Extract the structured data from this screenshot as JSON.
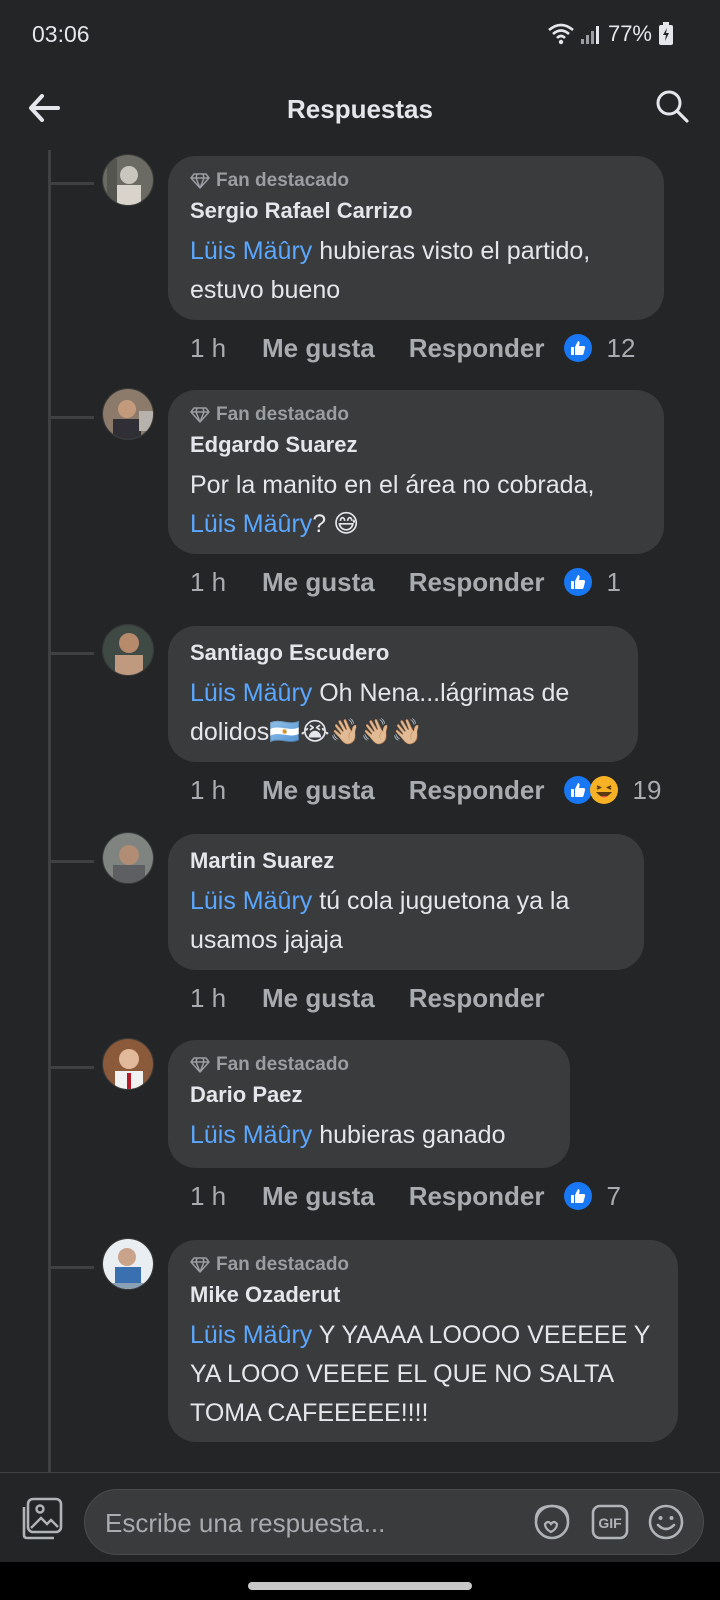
{
  "status_bar": {
    "time": "03:06",
    "battery": "77%"
  },
  "header": {
    "title": "Respuestas"
  },
  "comments": [
    {
      "fan_badge": "Fan destacado",
      "author": "Sergio Rafael Carrizo",
      "mention": "Lüis Mäûry",
      "text": " hubieras visto el partido, estuvo bueno",
      "time": "1 h",
      "like_label": "Me gusta",
      "reply_label": "Responder",
      "reaction_count": "12"
    },
    {
      "fan_badge": "Fan destacado",
      "author": "Edgardo Suarez",
      "text_before": "Por la manito en el área no cobrada, ",
      "mention": "Lüis Mäûry",
      "text_after": "? 😅",
      "time": "1 h",
      "like_label": "Me gusta",
      "reply_label": "Responder",
      "reaction_count": "1"
    },
    {
      "author": "Santiago Escudero",
      "mention": "Lüis Mäûry",
      "text": " Oh Nena...lágrimas de dolidos🇦🇷😭👋🏼👋🏼👋🏼",
      "time": "1 h",
      "like_label": "Me gusta",
      "reply_label": "Responder",
      "reaction_count": "19"
    },
    {
      "author": "Martin Suarez",
      "mention": "Lüis Mäûry",
      "text": " tú cola juguetona ya la usamos jajaja",
      "time": "1 h",
      "like_label": "Me gusta",
      "reply_label": "Responder"
    },
    {
      "fan_badge": "Fan destacado",
      "author": "Dario Paez",
      "mention": "Lüis Mäûry",
      "text": " hubieras ganado",
      "time": "1 h",
      "like_label": "Me gusta",
      "reply_label": "Responder",
      "reaction_count": "7"
    },
    {
      "fan_badge": "Fan destacado",
      "author": "Mike Ozaderut",
      "mention": "Lüis Mäûry",
      "text": " Y YAAAA LOOOO VEEEEE Y YA LOOO VEEEE EL QUE NO SALTA TOMA CAFEEEEE!!!!"
    }
  ],
  "composer": {
    "placeholder": "Escribe una respuesta..."
  },
  "colors": {
    "background": "#242526",
    "bubble": "#3a3b3c",
    "mention": "#5aa7ff",
    "like": "#1877f2"
  }
}
